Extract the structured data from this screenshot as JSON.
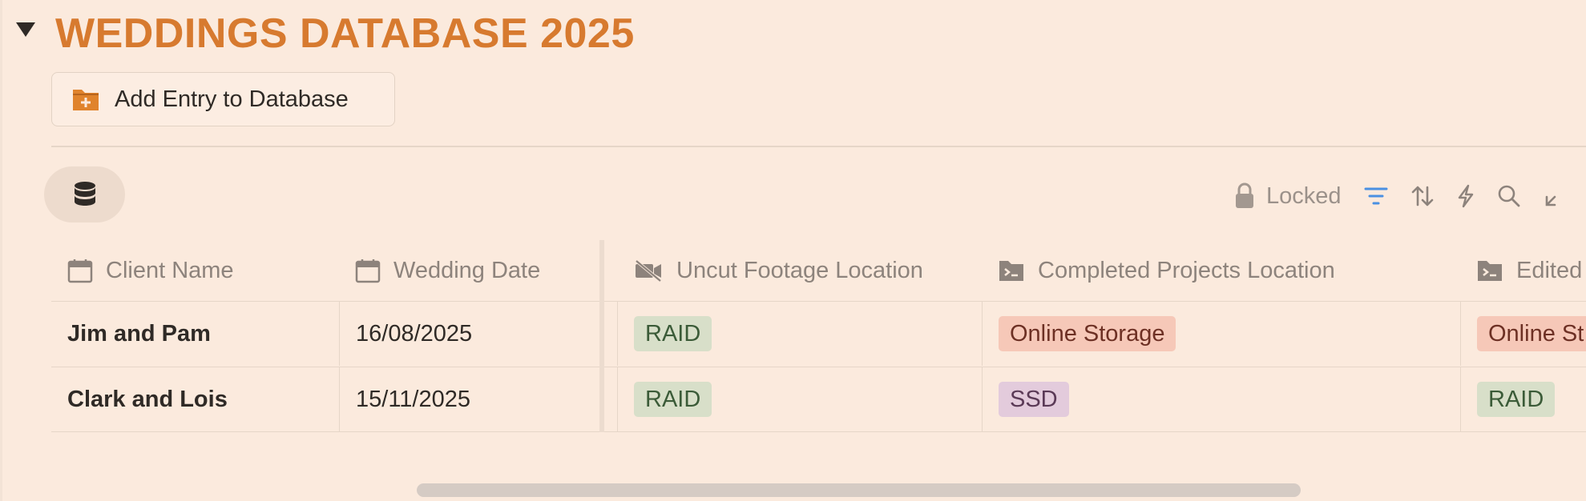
{
  "page": {
    "title": "WEDDINGS DATABASE 2025",
    "add_button_label": "Add Entry to Database"
  },
  "toolbar": {
    "lock_label": "Locked",
    "icons": [
      "lock-icon",
      "filter-icon",
      "sort-icon",
      "automation-icon",
      "search-icon",
      "collapse-icon"
    ],
    "accent_color": "#4a90e2"
  },
  "table": {
    "columns": [
      "Client Name",
      "Wedding Date",
      "Uncut Footage Location",
      "Completed Projects Location",
      "Edited"
    ],
    "rows": [
      {
        "client": "Jim and Pam",
        "date": "16/08/2025",
        "uncut": "RAID",
        "completed": "Online Storage",
        "edited": "Online St"
      },
      {
        "client": "Clark and Lois",
        "date": "15/11/2025",
        "uncut": "RAID",
        "completed": "SSD",
        "edited": "RAID"
      }
    ]
  },
  "colors": {
    "background": "#fbeadd",
    "title": "#d77a2f",
    "tag_green": "#d8dfc9",
    "tag_red": "#f6c8b8",
    "tag_purple": "#e3cbdc"
  }
}
